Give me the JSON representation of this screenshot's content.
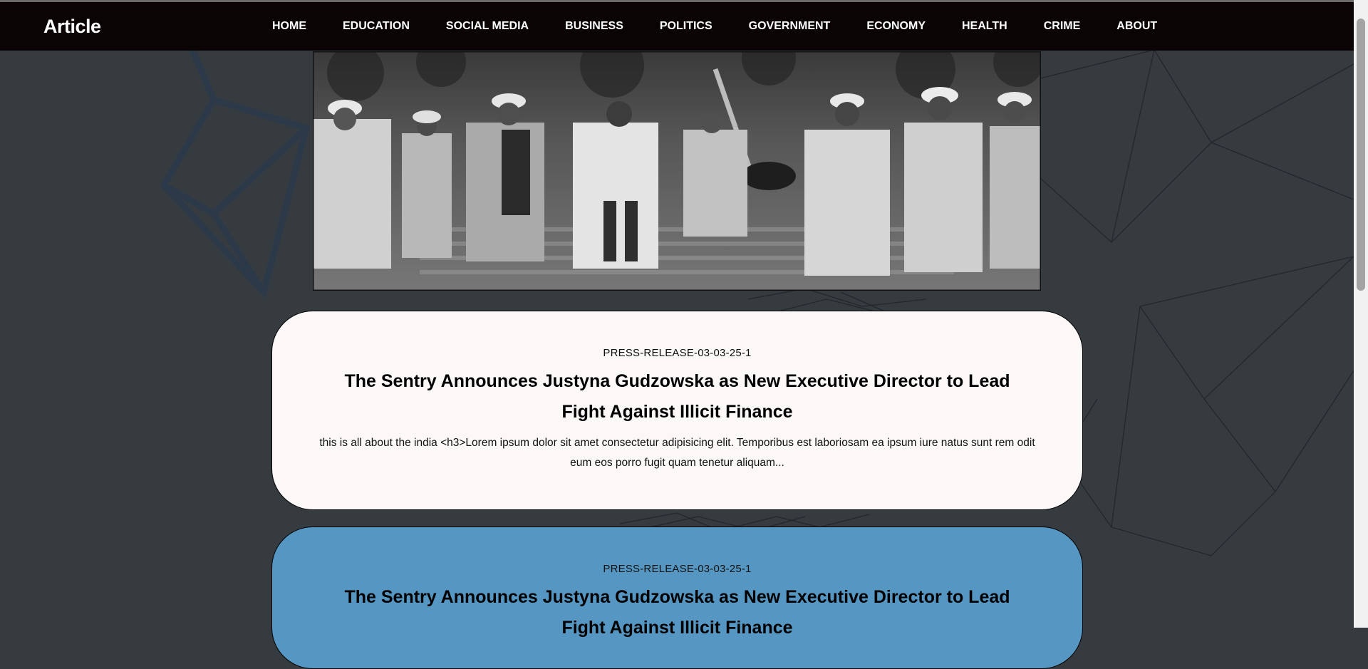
{
  "brand": "Article",
  "nav": [
    "HOME",
    "EDUCATION",
    "SOCIAL MEDIA",
    "BUSINESS",
    "POLITICS",
    "GOVERNMENT",
    "ECONOMY",
    "HEALTH",
    "CRIME",
    "ABOUT"
  ],
  "articles": [
    {
      "tag": "PRESS-RELEASE-03-03-25-1",
      "title": "The Sentry Announces Justyna Gudzowska as New Executive Director to Lead Fight Against Illicit Finance",
      "excerpt": "this is all about the india <h3>Lorem ipsum dolor sit amet consectetur adipisicing elit. Temporibus est laboriosam ea ipsum iure natus sunt rem odit eum eos porro fugit quam tenetur aliquam..."
    },
    {
      "tag": "PRESS-RELEASE-03-03-25-1",
      "title": "The Sentry Announces Justyna Gudzowska as New Executive Director to Lead Fight Against Illicit Finance",
      "excerpt": ""
    }
  ],
  "colors": {
    "background": "#363b40",
    "navbar": "#0b0404",
    "card_light": "#fcf8f7",
    "card_blue": "#5597c2"
  }
}
